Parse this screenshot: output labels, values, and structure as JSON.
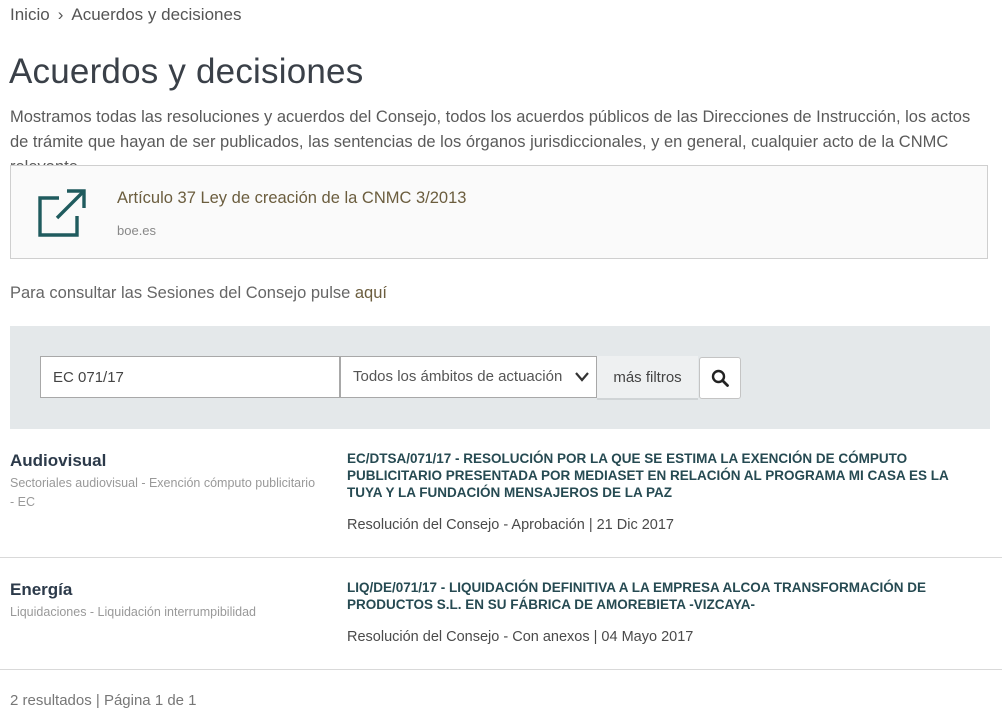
{
  "breadcrumb": {
    "home": "Inicio",
    "separator": "›",
    "current": "Acuerdos y decisiones"
  },
  "page": {
    "title": "Acuerdos y decisiones",
    "intro": "Mostramos todas las resoluciones y acuerdos del Consejo, todos los acuerdos públicos de las Direcciones de Instrucción, los actos de trámite que hayan de ser publicados, las sentencias de los órganos jurisdiccionales, y en general, cualquier acto de la CNMC relevante."
  },
  "link_card": {
    "icon": "external-link-icon",
    "title": "Artículo 37 Ley de creación de la CNMC 3/2013",
    "domain": "boe.es"
  },
  "sessions": {
    "text": "Para consultar las Sesiones del Consejo pulse ",
    "link": "aquí"
  },
  "search": {
    "query": "EC 071/17",
    "ambit_selected": "Todos los ámbitos de actuación",
    "more_filters_label": "más filtros",
    "search_icon": "search-icon"
  },
  "results": [
    {
      "sector": "Audiovisual",
      "subsector": "Sectoriales audiovisual - Exención cómputo publicitario - EC",
      "title": "EC/DTSA/071/17 - RESOLUCIÓN POR LA QUE SE ESTIMA LA EXENCIÓN DE CÓMPUTO PUBLICITARIO PRESENTADA POR MEDIASET EN RELACIÓN AL PROGRAMA MI CASA ES LA TUYA Y LA FUNDACIÓN MENSAJEROS DE LA PAZ",
      "meta": "Resolución del Consejo - Aprobación | 21 Dic 2017"
    },
    {
      "sector": "Energía",
      "subsector": "Liquidaciones - Liquidación interrumpibilidad",
      "title": "LIQ/DE/071/17 - LIQUIDACIÓN DEFINITIVA A LA EMPRESA ALCOA TRANSFORMACIÓN DE PRODUCTOS S.L. EN SU FÁBRICA DE AMOREBIETA -VIZCAYA-",
      "meta": "Resolución del Consejo - Con anexos | 04 Mayo 2017"
    }
  ],
  "pagination": "2 resultados | Página 1 de 1",
  "colors": {
    "accent_link": "#6b5d3e",
    "title_teal": "#264a52",
    "icon_teal": "#1f5b5e",
    "panel_bg": "#e4e8ea"
  }
}
